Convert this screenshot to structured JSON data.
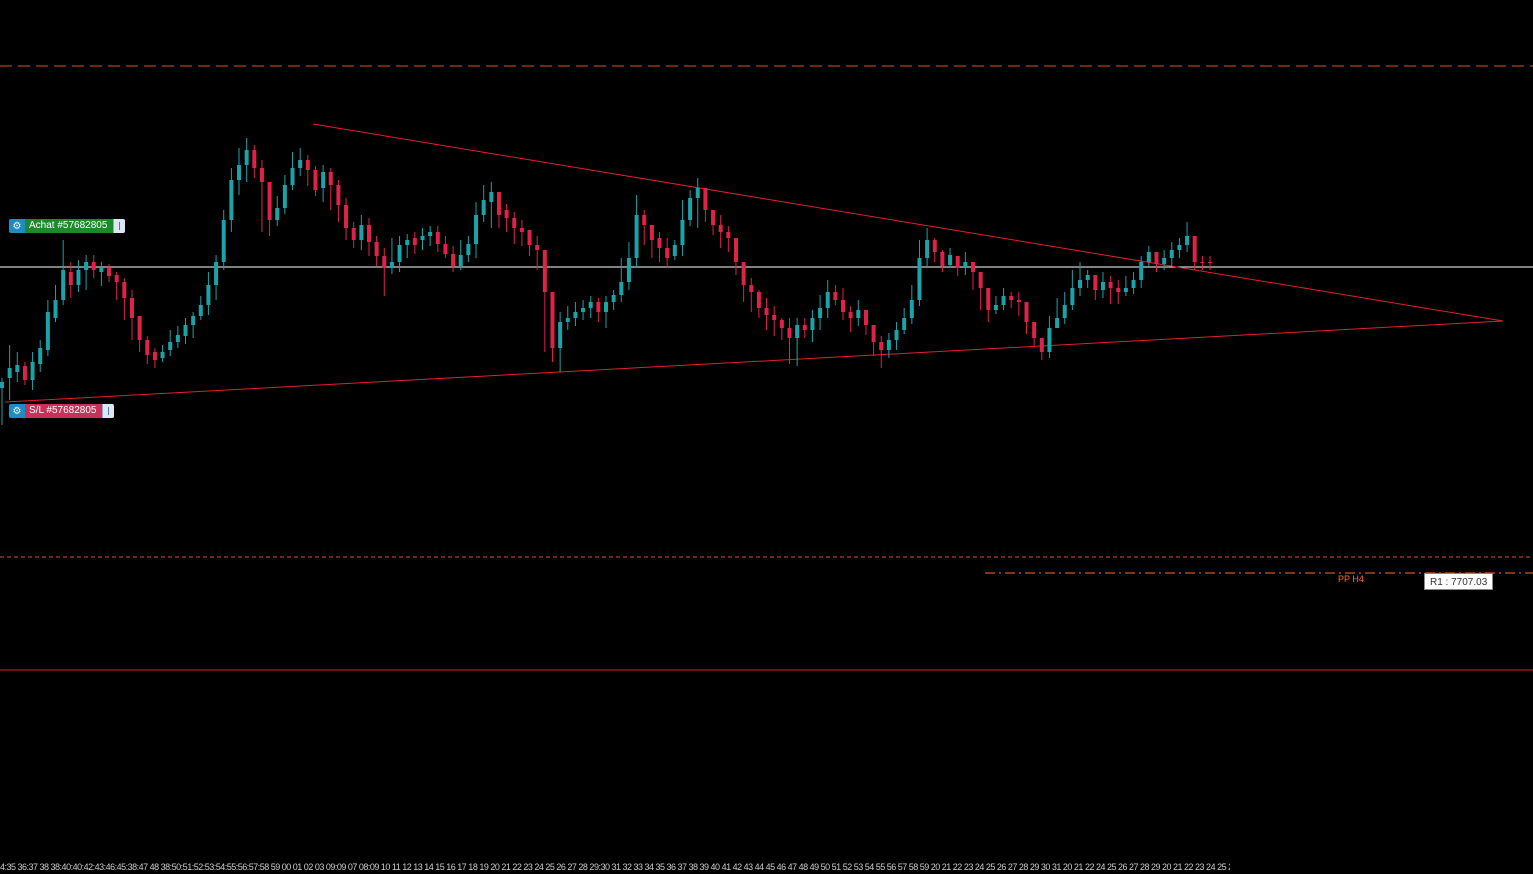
{
  "colors": {
    "background": "#000000",
    "bull_candle": "#1aa3a8",
    "bear_candle": "#e0224b",
    "trendline": "#e0202a",
    "price_line": "#ffffff",
    "pivot_orange": "#ff6a28",
    "support_red": "#e0202a"
  },
  "orders": {
    "buy": {
      "label": "Achat #57682805",
      "gear_icon": "gear-icon"
    },
    "stoploss": {
      "label": "S/L #57682805",
      "gear_icon": "gear-icon"
    }
  },
  "pivots": {
    "pp_label": "PP H4",
    "r1_label": "R1 : 7707.03"
  },
  "time_axis": {
    "text": "4:35 36:37 38 38:40:40:42:43:46:45:38:47 48 38:50:51:52:53:54:55:56:57:58 59 00 01 02 03 09:09 07 08:09 10 11 12 13 14 15 16 17 18 19 20 21 22 23 24 25 26 27 28 29:30 31 32 33 34 35 36 37 38 39 40 41 42 43 44 45 46 47 48 49 50 51 52 53 54 55 56 57 58 59 20 21 22 23 24 25 26 27 28 29 30 31 20 21 22 24 25 26 27 28 29 20 21 22 23 24 25 26 27"
  },
  "chart_data": {
    "type": "candlestick",
    "title": "",
    "xlabel": "",
    "ylabel": "",
    "candles": [
      [
        388,
        382,
        378,
        425
      ],
      [
        378,
        368,
        345,
        400
      ],
      [
        372,
        365,
        352,
        382
      ],
      [
        366,
        380,
        362,
        385
      ],
      [
        380,
        362,
        352,
        390
      ],
      [
        364,
        348,
        340,
        372
      ],
      [
        350,
        312,
        300,
        356
      ],
      [
        318,
        300,
        285,
        322
      ],
      [
        300,
        270,
        240,
        305
      ],
      [
        272,
        285,
        262,
        298
      ],
      [
        285,
        270,
        260,
        292
      ],
      [
        270,
        262,
        255,
        290
      ],
      [
        262,
        270,
        255,
        278
      ],
      [
        272,
        268,
        262,
        286
      ],
      [
        268,
        276,
        264,
        282
      ],
      [
        275,
        282,
        272,
        300
      ],
      [
        282,
        298,
        278,
        320
      ],
      [
        298,
        318,
        290,
        340
      ],
      [
        316,
        340,
        318,
        352
      ],
      [
        340,
        355,
        336,
        364
      ],
      [
        352,
        360,
        348,
        368
      ],
      [
        358,
        352,
        345,
        362
      ],
      [
        350,
        342,
        330,
        356
      ],
      [
        342,
        335,
        326,
        348
      ],
      [
        336,
        325,
        318,
        344
      ],
      [
        325,
        316,
        312,
        338
      ],
      [
        316,
        305,
        296,
        320
      ],
      [
        305,
        285,
        272,
        315
      ],
      [
        285,
        262,
        255,
        300
      ],
      [
        262,
        220,
        210,
        270
      ],
      [
        220,
        180,
        168,
        232
      ],
      [
        180,
        165,
        148,
        195
      ],
      [
        165,
        150,
        138,
        182
      ],
      [
        150,
        168,
        145,
        178
      ],
      [
        168,
        182,
        160,
        232
      ],
      [
        182,
        220,
        200,
        236
      ],
      [
        220,
        208,
        196,
        226
      ],
      [
        208,
        185,
        175,
        214
      ],
      [
        185,
        168,
        152,
        190
      ],
      [
        168,
        160,
        148,
        176
      ],
      [
        160,
        170,
        155,
        186
      ],
      [
        170,
        190,
        166,
        196
      ],
      [
        188,
        172,
        165,
        202
      ],
      [
        172,
        185,
        168,
        210
      ],
      [
        185,
        205,
        180,
        222
      ],
      [
        205,
        228,
        198,
        240
      ],
      [
        228,
        240,
        222,
        248
      ],
      [
        240,
        225,
        215,
        250
      ],
      [
        225,
        242,
        218,
        256
      ],
      [
        242,
        256,
        236,
        266
      ],
      [
        256,
        268,
        248,
        296
      ],
      [
        268,
        262,
        238,
        274
      ],
      [
        262,
        245,
        236,
        272
      ],
      [
        245,
        240,
        234,
        258
      ],
      [
        238,
        245,
        232,
        254
      ],
      [
        240,
        236,
        228,
        250
      ],
      [
        236,
        232,
        226,
        246
      ],
      [
        232,
        244,
        226,
        252
      ],
      [
        244,
        254,
        236,
        258
      ],
      [
        254,
        266,
        246,
        272
      ],
      [
        266,
        255,
        240,
        270
      ],
      [
        255,
        244,
        236,
        262
      ],
      [
        244,
        215,
        202,
        258
      ],
      [
        215,
        200,
        185,
        222
      ],
      [
        202,
        192,
        182,
        228
      ],
      [
        192,
        215,
        198,
        228
      ],
      [
        210,
        218,
        204,
        232
      ],
      [
        218,
        228,
        212,
        244
      ],
      [
        228,
        232,
        220,
        246
      ],
      [
        230,
        245,
        238,
        256
      ],
      [
        245,
        250,
        236,
        270
      ],
      [
        250,
        292,
        265,
        352
      ],
      [
        292,
        348,
        305,
        362
      ],
      [
        348,
        322,
        312,
        372
      ],
      [
        322,
        318,
        306,
        330
      ],
      [
        318,
        312,
        302,
        326
      ],
      [
        312,
        308,
        300,
        320
      ],
      [
        308,
        302,
        296,
        318
      ],
      [
        302,
        312,
        298,
        322
      ],
      [
        312,
        302,
        296,
        328
      ],
      [
        302,
        295,
        290,
        310
      ],
      [
        295,
        282,
        258,
        302
      ],
      [
        282,
        258,
        242,
        290
      ],
      [
        258,
        215,
        195,
        268
      ],
      [
        215,
        225,
        210,
        245
      ],
      [
        225,
        240,
        228,
        258
      ],
      [
        238,
        248,
        232,
        262
      ],
      [
        248,
        258,
        238,
        268
      ],
      [
        256,
        245,
        240,
        260
      ],
      [
        245,
        220,
        200,
        256
      ],
      [
        220,
        198,
        190,
        226
      ],
      [
        198,
        188,
        178,
        228
      ],
      [
        188,
        210,
        192,
        222
      ],
      [
        210,
        225,
        212,
        235
      ],
      [
        225,
        232,
        215,
        248
      ],
      [
        232,
        238,
        226,
        252
      ],
      [
        238,
        262,
        242,
        275
      ],
      [
        262,
        285,
        268,
        302
      ],
      [
        285,
        292,
        278,
        312
      ],
      [
        292,
        308,
        290,
        318
      ],
      [
        308,
        315,
        298,
        330
      ],
      [
        315,
        320,
        306,
        336
      ],
      [
        320,
        328,
        318,
        340
      ],
      [
        328,
        338,
        318,
        364
      ],
      [
        338,
        325,
        318,
        366
      ],
      [
        325,
        330,
        318,
        338
      ],
      [
        330,
        318,
        310,
        342
      ],
      [
        318,
        308,
        295,
        330
      ],
      [
        308,
        292,
        280,
        318
      ],
      [
        292,
        300,
        285,
        305
      ],
      [
        300,
        312,
        288,
        320
      ],
      [
        312,
        318,
        306,
        332
      ],
      [
        318,
        310,
        300,
        326
      ],
      [
        310,
        325,
        312,
        335
      ],
      [
        325,
        342,
        328,
        356
      ],
      [
        342,
        350,
        336,
        368
      ],
      [
        350,
        340,
        333,
        358
      ],
      [
        340,
        330,
        322,
        350
      ],
      [
        330,
        318,
        308,
        334
      ],
      [
        318,
        300,
        285,
        324
      ],
      [
        300,
        258,
        240,
        306
      ],
      [
        258,
        240,
        228,
        266
      ],
      [
        240,
        252,
        238,
        262
      ],
      [
        252,
        266,
        250,
        272
      ],
      [
        265,
        255,
        248,
        268
      ],
      [
        256,
        268,
        258,
        276
      ],
      [
        268,
        262,
        252,
        275
      ],
      [
        262,
        272,
        264,
        290
      ],
      [
        272,
        288,
        280,
        310
      ],
      [
        288,
        310,
        296,
        322
      ],
      [
        310,
        305,
        296,
        314
      ],
      [
        305,
        296,
        288,
        310
      ],
      [
        296,
        300,
        292,
        308
      ],
      [
        300,
        302,
        292,
        316
      ],
      [
        302,
        322,
        310,
        334
      ],
      [
        322,
        338,
        328,
        346
      ],
      [
        338,
        352,
        340,
        360
      ],
      [
        352,
        328,
        316,
        358
      ],
      [
        328,
        318,
        298,
        328
      ],
      [
        318,
        305,
        292,
        324
      ],
      [
        305,
        288,
        270,
        310
      ],
      [
        288,
        280,
        262,
        296
      ],
      [
        280,
        275,
        270,
        288
      ],
      [
        275,
        290,
        282,
        300
      ],
      [
        290,
        282,
        272,
        298
      ],
      [
        282,
        288,
        276,
        304
      ],
      [
        288,
        292,
        280,
        304
      ],
      [
        292,
        288,
        276,
        296
      ],
      [
        288,
        280,
        272,
        294
      ],
      [
        280,
        262,
        256,
        288
      ],
      [
        262,
        252,
        246,
        268
      ],
      [
        252,
        264,
        256,
        272
      ],
      [
        264,
        258,
        250,
        270
      ],
      [
        258,
        250,
        242,
        266
      ],
      [
        250,
        245,
        238,
        258
      ],
      [
        245,
        236,
        222,
        252
      ],
      [
        236,
        262,
        250,
        270
      ],
      [
        262,
        262,
        256,
        270
      ],
      [
        262,
        262,
        256,
        270
      ]
    ],
    "y_pixel_note": "",
    "price_marker": "R1 : 7707.03"
  }
}
